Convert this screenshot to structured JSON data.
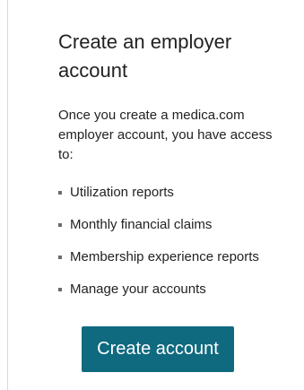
{
  "card": {
    "title": "Create an employer account",
    "intro": "Once you create a medica.com employer account, you have access to:",
    "features": [
      "Utilization reports",
      "Monthly financial claims",
      "Membership experience reports",
      "Manage your accounts"
    ],
    "create_button_label": "Create account"
  },
  "colors": {
    "button_background": "#0f6a80",
    "button_text": "#ffffff",
    "text": "#222222",
    "bullet": "#6b6b6b",
    "card_border": "#d9d9d9"
  },
  "icons": {
    "bullet": "square-bullet-icon"
  }
}
